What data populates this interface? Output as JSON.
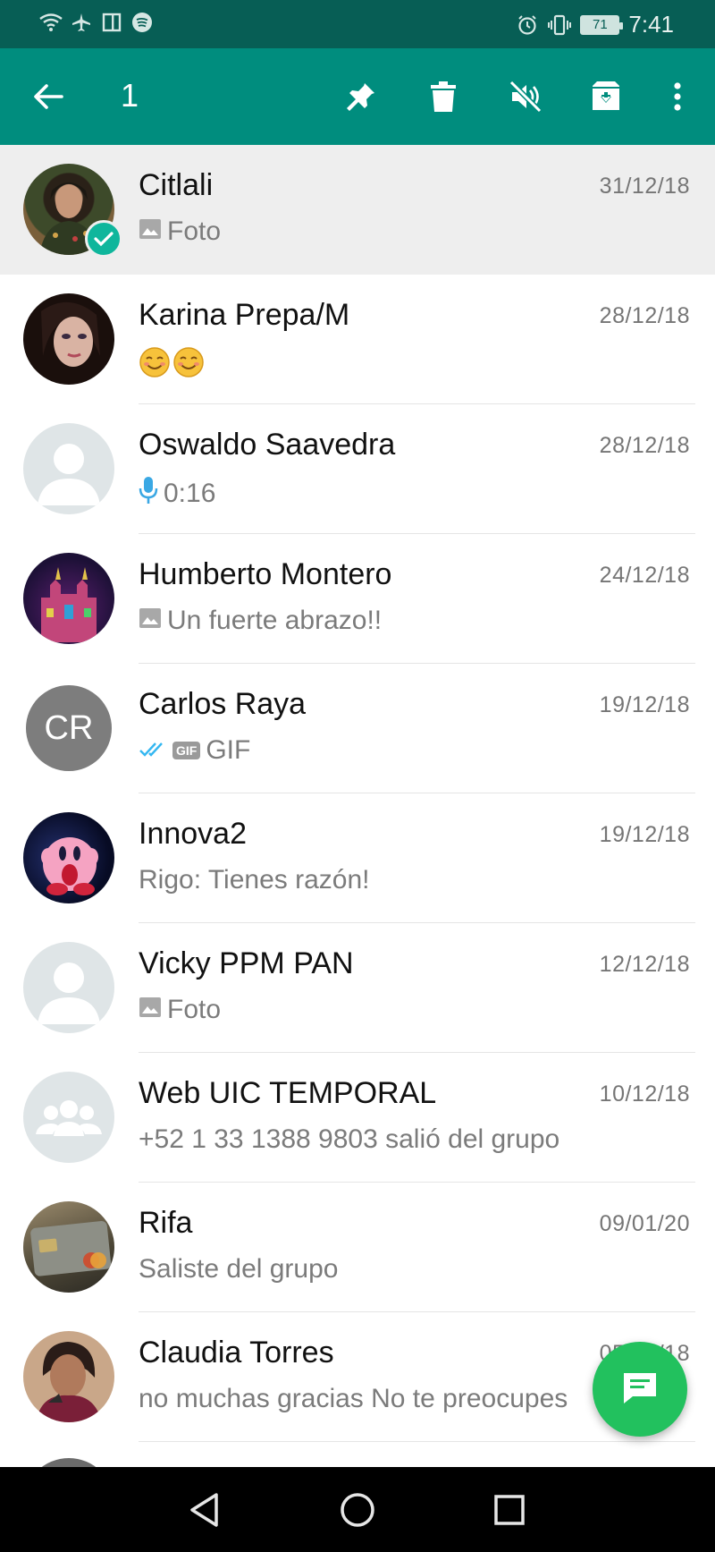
{
  "status_bar": {
    "time": "7:41",
    "battery_level": "71",
    "left_icons": [
      "wifi-icon",
      "airplane-icon",
      "sim-icon",
      "spotify-icon"
    ],
    "right_icons": [
      "alarm-icon",
      "vibrate-icon",
      "battery-icon"
    ]
  },
  "action_bar": {
    "selected_count": "1",
    "actions": [
      "back-arrow-icon",
      "pin-icon",
      "trash-icon",
      "mute-icon",
      "archive-icon",
      "overflow-menu-icon"
    ]
  },
  "colors": {
    "status_bar": "#075e55",
    "action_bar": "#008d7e",
    "selected_row": "#eeeeee",
    "fab": "#22c15e",
    "check_badge": "#0fb69c",
    "mic_blue": "#3aa8e4",
    "tick_blue": "#34b7f1"
  },
  "chats": [
    {
      "name": "Citlali",
      "date": "31/12/18",
      "preview": "Foto",
      "preview_icon": "photo-icon",
      "selected": true,
      "avatar": "photo"
    },
    {
      "name": "Karina Prepa/M",
      "date": "28/12/18",
      "preview": "☺☺",
      "preview_icon": "",
      "avatar": "photo"
    },
    {
      "name": "Oswaldo Saavedra",
      "date": "28/12/18",
      "preview": "0:16",
      "preview_icon": "mic-icon",
      "avatar": "default-person"
    },
    {
      "name": "Humberto Montero",
      "date": "24/12/18",
      "preview": "Un fuerte abrazo!!",
      "preview_icon": "photo-icon",
      "avatar": "photo"
    },
    {
      "name": "Carlos Raya",
      "date": "19/12/18",
      "preview": "GIF",
      "preview_icon": "gif-icon",
      "avatar_initials": "CR"
    },
    {
      "name": "Innova2",
      "date": "19/12/18",
      "preview": "Rigo: Tienes razón!",
      "preview_icon": "",
      "avatar": "photo"
    },
    {
      "name": "Vicky PPM PAN",
      "date": "12/12/18",
      "preview": "Foto",
      "preview_icon": "photo-icon",
      "avatar": "default-person"
    },
    {
      "name": "Web UIC TEMPORAL",
      "date": "10/12/18",
      "preview": "+52 1 33 1388 9803 salió del grupo",
      "preview_icon": "",
      "avatar": "default-group"
    },
    {
      "name": "Rifa",
      "date": "09/01/20",
      "preview": "Saliste del grupo",
      "preview_icon": "",
      "avatar": "photo"
    },
    {
      "name": "Claudia Torres",
      "date": "05/12/18",
      "preview": "no muchas gracias No te preocupes",
      "preview_icon": "",
      "avatar": "photo"
    }
  ],
  "fab": {
    "icon": "new-chat-icon"
  },
  "nav_bar": {
    "buttons": [
      "back-triangle-icon",
      "home-circle-icon",
      "recents-square-icon"
    ]
  }
}
